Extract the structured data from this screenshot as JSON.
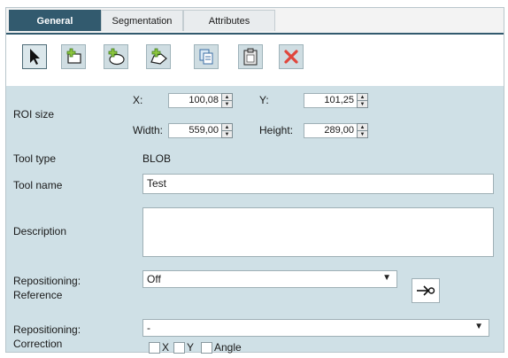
{
  "tabs": [
    {
      "label": "General",
      "active": true
    },
    {
      "label": "Segmentation",
      "active": false
    },
    {
      "label": "Attributes",
      "active": false
    }
  ],
  "toolbar": {
    "buttons": [
      {
        "icon": "select-arrow-icon"
      },
      {
        "icon": "add-rectangle-icon"
      },
      {
        "icon": "add-ellipse-icon"
      },
      {
        "icon": "add-polygon-icon"
      },
      {
        "icon": "copy-icon"
      },
      {
        "icon": "paste-icon"
      },
      {
        "icon": "delete-icon"
      }
    ]
  },
  "roi": {
    "label": "ROI size",
    "x_label": "X:",
    "x_value": "100,08",
    "y_label": "Y:",
    "y_value": "101,25",
    "width_label": "Width:",
    "width_value": "559,00",
    "height_label": "Height:",
    "height_value": "289,00"
  },
  "tool_type": {
    "label": "Tool type",
    "value": "BLOB"
  },
  "tool_name": {
    "label": "Tool name",
    "value": "Test"
  },
  "description": {
    "label": "Description",
    "value": ""
  },
  "repositioning_reference": {
    "label_line1": "Repositioning:",
    "label_line2": "Reference",
    "selected": "Off"
  },
  "repositioning_correction": {
    "label_line1": "Repositioning:",
    "label_line2": "Correction",
    "selected": "-",
    "checkboxes": [
      {
        "label": "X",
        "checked": false
      },
      {
        "label": "Y",
        "checked": false
      },
      {
        "label": "Angle",
        "checked": false
      }
    ]
  },
  "colors": {
    "tab_active": "#325a6e",
    "panel_bg": "#cfe0e6",
    "delete_red": "#e0463c"
  }
}
